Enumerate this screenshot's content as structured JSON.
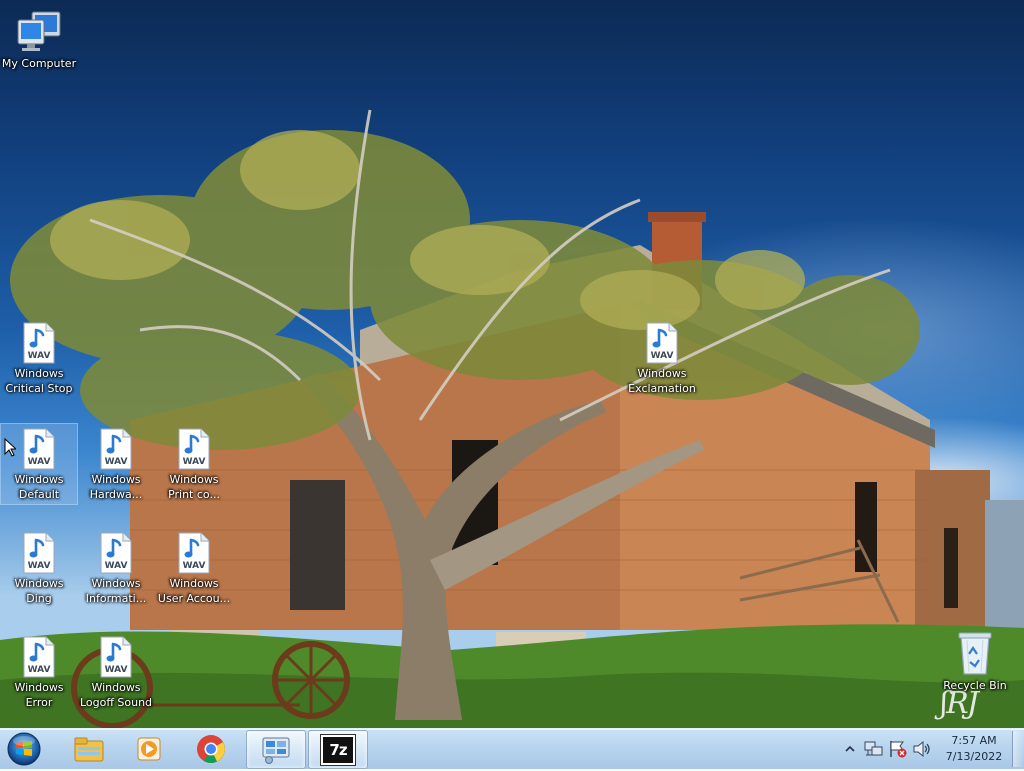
{
  "desktop": {
    "icons": [
      {
        "name": "my-computer-icon",
        "label": "My Computer",
        "type": "computer"
      },
      {
        "name": "windows-critical-stop-wav-icon",
        "label": "Windows\nCritical Stop",
        "type": "wav"
      },
      {
        "name": "windows-exclamation-wav-icon",
        "label": "Windows\nExclamation",
        "type": "wav"
      },
      {
        "name": "windows-default-wav-icon",
        "label": "Windows\nDefault",
        "type": "wav",
        "selected": true
      },
      {
        "name": "windows-hardware-wav-icon",
        "label": "Windows\nHardwa...",
        "type": "wav"
      },
      {
        "name": "windows-print-complete-wav-icon",
        "label": "Windows\nPrint co...",
        "type": "wav"
      },
      {
        "name": "windows-ding-wav-icon",
        "label": "Windows\nDing",
        "type": "wav"
      },
      {
        "name": "windows-information-wav-icon",
        "label": "Windows\nInformati...",
        "type": "wav"
      },
      {
        "name": "windows-user-account-wav-icon",
        "label": "Windows\nUser Accou...",
        "type": "wav"
      },
      {
        "name": "windows-error-wav-icon",
        "label": "Windows\nError",
        "type": "wav"
      },
      {
        "name": "windows-logoff-sound-wav-icon",
        "label": "Windows\nLogoff Sound",
        "type": "wav"
      },
      {
        "name": "recycle-bin-icon",
        "label": "Recycle Bin",
        "type": "recycle"
      }
    ],
    "file_badge": "WAV"
  },
  "taskbar": {
    "start_button": "windows-orb-icon",
    "pinned": [
      {
        "name": "file-explorer-icon"
      },
      {
        "name": "media-player-icon"
      },
      {
        "name": "chrome-icon"
      },
      {
        "name": "control-panel-icon",
        "active": true
      },
      {
        "name": "7zip-icon",
        "label": "7z",
        "active": true
      }
    ],
    "tray_icons": [
      "show-hidden-icons-arrow",
      "network-icon",
      "action-center-flag-icon",
      "volume-icon"
    ],
    "clock": {
      "time": "7:57 AM",
      "date": "7/13/2022"
    }
  },
  "colors": {
    "taskbar": "#b8d4ee",
    "sky_top": "#0c2a55",
    "sky_bottom": "#a9cdec",
    "grass": "#4f8a2a",
    "brick": "#c0784a"
  }
}
